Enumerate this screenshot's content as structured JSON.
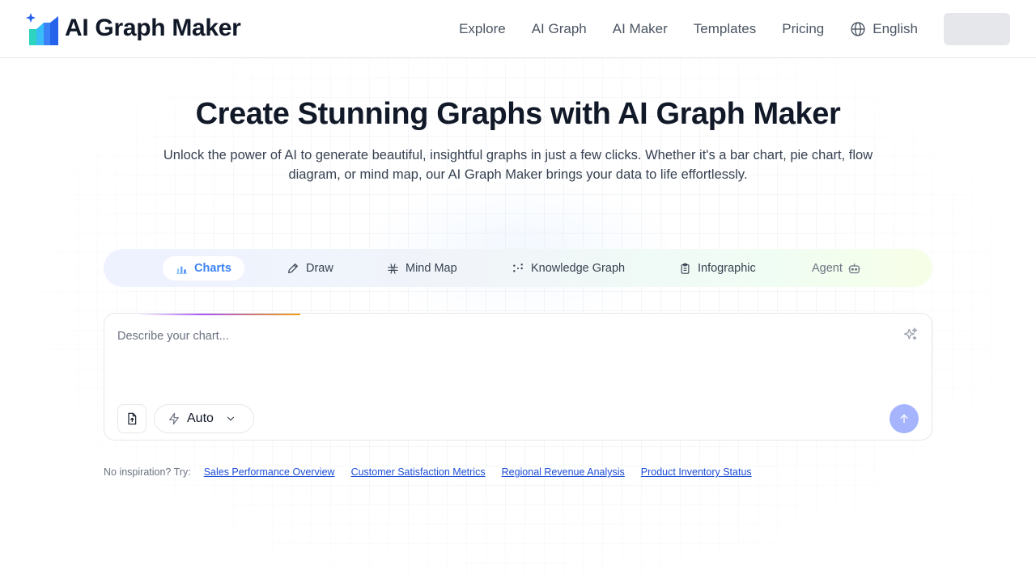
{
  "header": {
    "logo_text": "AI Graph Maker",
    "nav": [
      "Explore",
      "AI Graph",
      "AI Maker",
      "Templates",
      "Pricing"
    ],
    "language": "English"
  },
  "hero": {
    "title": "Create Stunning Graphs with AI Graph Maker",
    "subtitle": "Unlock the power of AI to generate beautiful, insightful graphs in just a few clicks. Whether it's a bar chart, pie chart, flow diagram, or mind map, our AI Graph Maker brings your data to life effortlessly."
  },
  "tabs": [
    {
      "label": "Charts",
      "icon": "bar-chart-icon",
      "active": true
    },
    {
      "label": "Draw",
      "icon": "pencil-icon",
      "active": false
    },
    {
      "label": "Mind Map",
      "icon": "mind-map-icon",
      "active": false
    },
    {
      "label": "Knowledge Graph",
      "icon": "knowledge-graph-icon",
      "active": false
    },
    {
      "label": "Infographic",
      "icon": "clipboard-icon",
      "active": false
    },
    {
      "label": "Agent",
      "icon": "robot-icon",
      "active": false
    }
  ],
  "editor": {
    "placeholder": "Describe your chart...",
    "value": "",
    "mode": "Auto"
  },
  "suggestions": {
    "lead": "No inspiration? Try:",
    "items": [
      "Sales Performance Overview",
      "Customer Satisfaction Metrics",
      "Regional Revenue Analysis",
      "Product Inventory Status"
    ]
  },
  "colors": {
    "accent": "#3b82f6",
    "send_button": "#a5b4fc",
    "link": "#1d4ed8"
  }
}
